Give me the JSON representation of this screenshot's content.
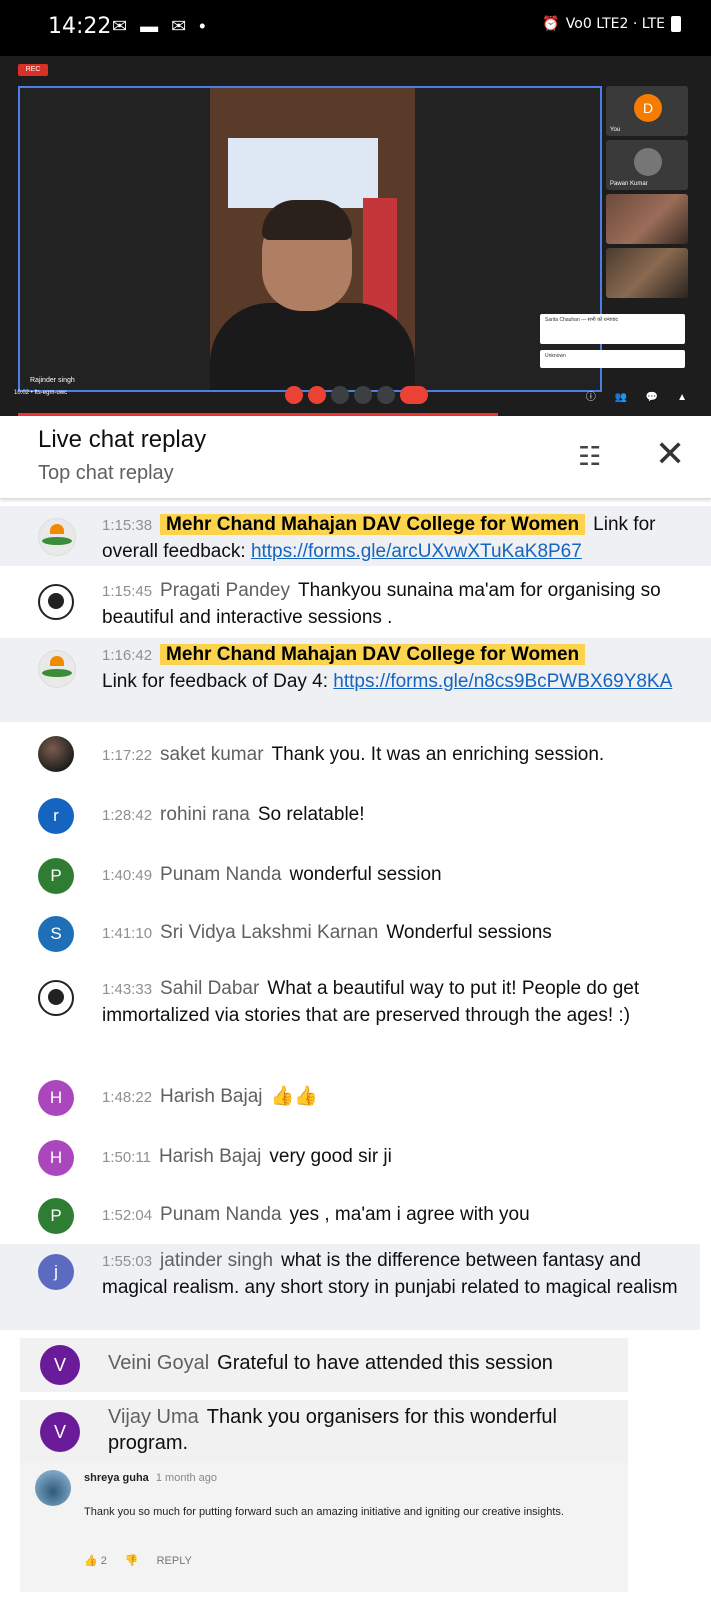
{
  "status_bar": {
    "time": "14:22",
    "notifications": "✉ ▬ ✉ •",
    "network": "Vo0 LTE2 · LTE"
  },
  "video": {
    "rec_label": "REC",
    "speaker": "Rajinder singh",
    "tiles": [
      {
        "avatar": "D",
        "label": "You"
      },
      {
        "label": "Pawan Kumar"
      },
      {
        "label": ""
      },
      {
        "label": ""
      }
    ],
    "mini_chat": [
      "Sarita Chauhan — सभी को धन्यवाद",
      "Unknown"
    ],
    "controls_left": "10:02 • fts-egm-uwc"
  },
  "chat": {
    "title": "Live chat replay",
    "subtitle": "Top chat replay",
    "messages": [
      {
        "time": "1:15:38",
        "author": "Mehr Chand Mahajan DAV College for Women",
        "text": "Link for overall feedback:",
        "link": "https://forms.gle/arcUXvwXTuKaK8P67"
      },
      {
        "time": "1:15:45",
        "author": "Pragati Pandey",
        "text": "Thankyou sunaina ma'am for organising so beautiful and interactive sessions ."
      },
      {
        "time": "1:16:42",
        "author": "Mehr Chand Mahajan DAV College for Women",
        "text": "Link for feedback of Day 4:",
        "link": "https://forms.gle/n8cs9BcPWBX69Y8KA"
      },
      {
        "time": "1:17:22",
        "author": "saket kumar",
        "text": "Thank you. It was an enriching session."
      },
      {
        "avatar": "r",
        "time": "1:28:42",
        "author": "rohini rana",
        "text": "So relatable!"
      },
      {
        "avatar": "P",
        "time": "1:40:49",
        "author": "Punam Nanda",
        "text": "wonderful session"
      },
      {
        "avatar": "S",
        "time": "1:41:10",
        "author": "Sri Vidya Lakshmi Karnan",
        "text": "Wonderful sessions"
      },
      {
        "time": "1:43:33",
        "author": "Sahil Dabar",
        "text": "What a beautiful way to put it! People do get immortalized via stories that are preserved through the ages! :)"
      },
      {
        "avatar": "H",
        "time": "1:48:22",
        "author": "Harish Bajaj",
        "text": "👍👍"
      },
      {
        "avatar": "H",
        "time": "1:50:11",
        "author": "Harish Bajaj",
        "text": "very good sir ji"
      },
      {
        "avatar": "P",
        "time": "1:52:04",
        "author": "Punam Nanda",
        "text": "yes , ma'am i agree with you"
      },
      {
        "avatar": "j",
        "time": "1:55:03",
        "author": "jatinder singh",
        "text": "what is the difference between fantasy and magical realism. any short story in punjabi related to magical realism"
      }
    ]
  },
  "extra_messages": [
    {
      "avatar": "V",
      "author": "Veini Goyal",
      "text": "Grateful to have attended this session"
    },
    {
      "avatar": "V",
      "author": "Vijay Uma",
      "text": "Thank you organisers for this wonderful program."
    }
  ],
  "comment": {
    "author": "shreya guha",
    "time": "1 month ago",
    "text": "Thank you so much for putting forward such an amazing initiative and igniting our creative insights.",
    "likes": "2",
    "reply_label": "REPLY"
  }
}
